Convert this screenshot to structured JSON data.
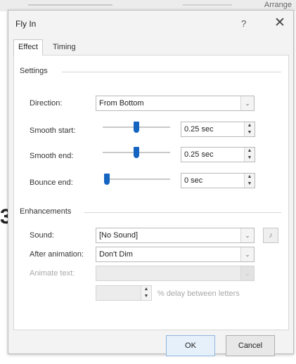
{
  "background": {
    "top_right_text": "Arrange",
    "left_glyph": "3"
  },
  "dialog": {
    "title": "Fly In",
    "help": "?",
    "close": "✕"
  },
  "tabs": [
    {
      "label": "Effect",
      "active": true
    },
    {
      "label": "Timing",
      "active": false
    }
  ],
  "settings": {
    "group_label": "Settings",
    "direction": {
      "label": "Direction:",
      "value": "From Bottom",
      "arrow": "⌄"
    },
    "smooth_start": {
      "label": "Smooth start:",
      "value": "0.25 sec",
      "level": 0.5
    },
    "smooth_end": {
      "label": "Smooth end:",
      "value": "0.25 sec",
      "level": 0.5
    },
    "bounce_end": {
      "label": "Bounce end:",
      "value": "0 sec",
      "level": 0.0
    }
  },
  "enhancements": {
    "group_label": "Enhancements",
    "sound": {
      "label": "Sound:",
      "value": "[No Sound]",
      "arrow": "⌄",
      "button_icon": "speaker-icon"
    },
    "after_animation": {
      "label": "After animation:",
      "value": "Don't Dim",
      "arrow": "⌄"
    },
    "animate_text": {
      "label": "Animate text:",
      "value": "",
      "arrow": "⌄"
    },
    "delay_between_letters": {
      "value": "",
      "label": "% delay between letters"
    }
  },
  "buttons": {
    "ok": "OK",
    "cancel": "Cancel"
  },
  "colors": {
    "accent": "#1565c0"
  }
}
